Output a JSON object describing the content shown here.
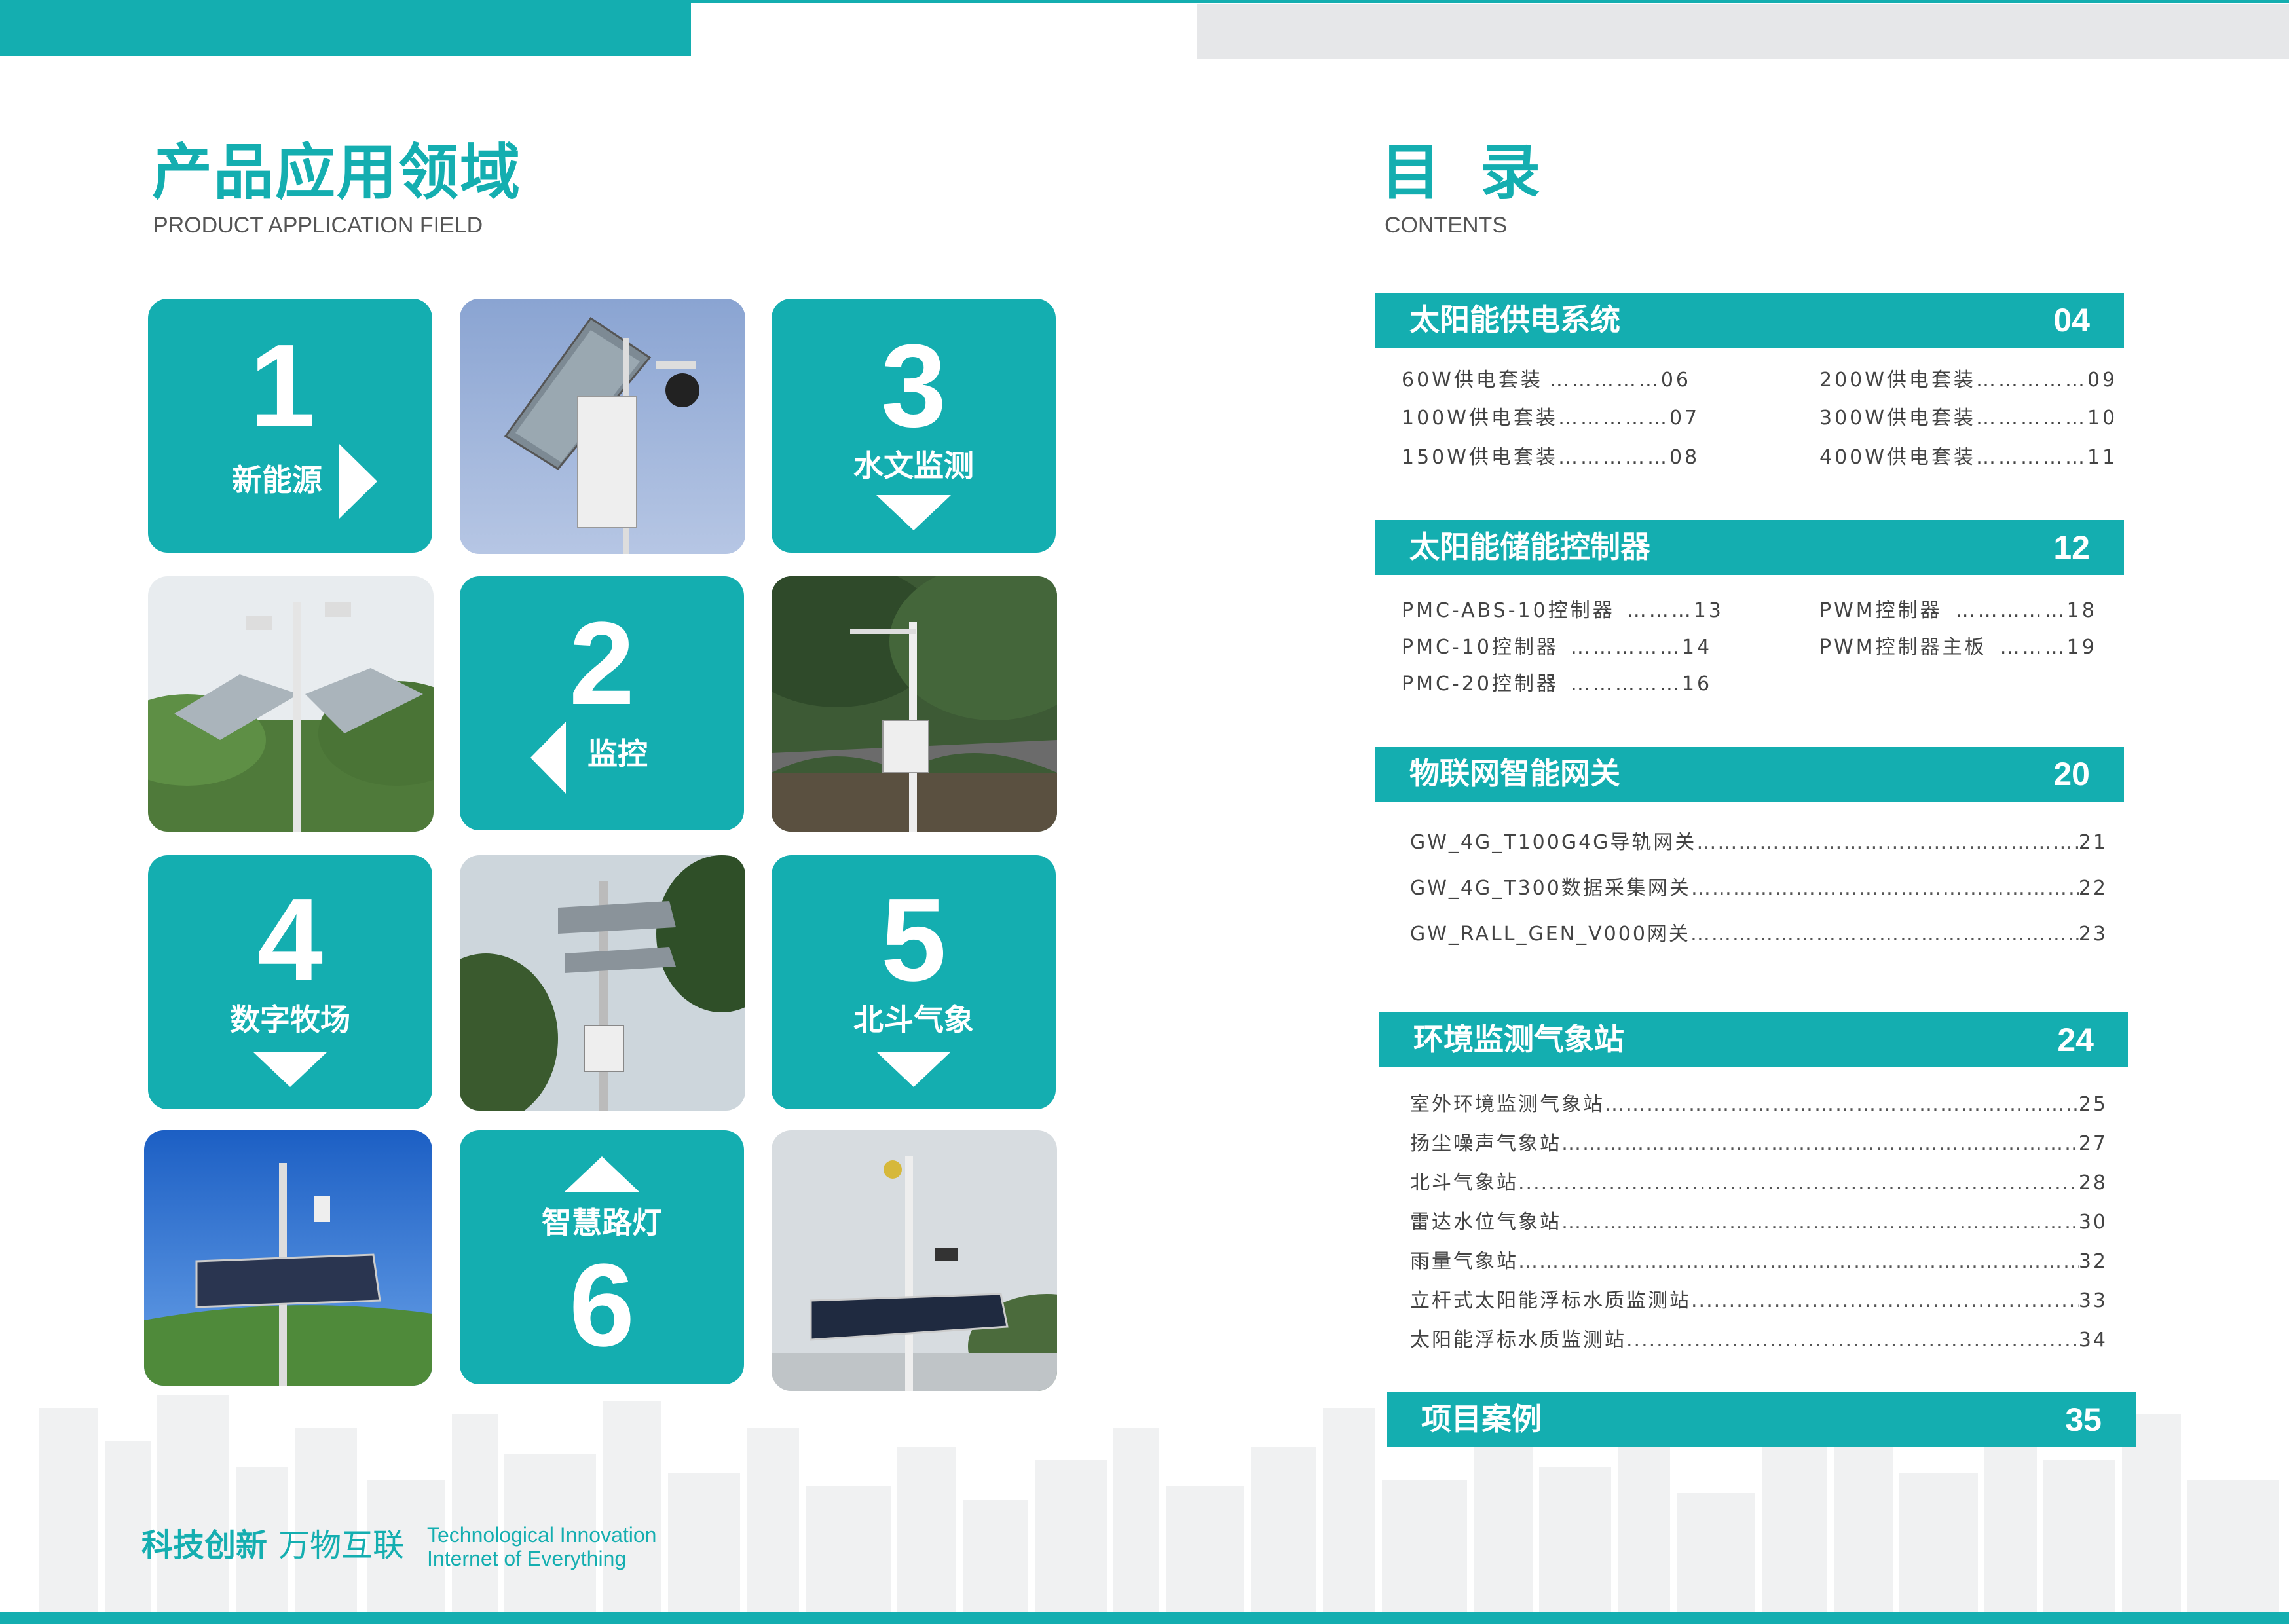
{
  "left": {
    "title": "产品应用领域",
    "subtitle": "PRODUCT APPLICATION FIELD",
    "tiles": [
      {
        "number": "1",
        "label": "新能源",
        "icon": "arrow-right-icon"
      },
      {
        "number": "3",
        "label": "水文监测",
        "icon": "arrow-down-icon"
      },
      {
        "number": "2",
        "label": "监控",
        "icon": "arrow-left-icon"
      },
      {
        "number": "4",
        "label": "数字牧场",
        "icon": "arrow-down-icon"
      },
      {
        "number": "5",
        "label": "北斗气象",
        "icon": "arrow-down-icon"
      },
      {
        "number": "6",
        "label": "智慧路灯",
        "icon": "arrow-up-icon"
      }
    ],
    "slogan_cn_bold": "科技创新",
    "slogan_cn": "万物互联",
    "slogan_en_1": "Technological Innovation",
    "slogan_en_2": "Internet of Everything"
  },
  "right": {
    "title": "目 录",
    "subtitle": "CONTENTS",
    "sections": [
      {
        "title": "太阳能供电系统",
        "page": "04",
        "items": [
          {
            "label": "60W供电套装",
            "dots": "……………",
            "page": "06"
          },
          {
            "label": "100W供电套装",
            "dots": "……………",
            "page": "07"
          },
          {
            "label": "150W供电套装",
            "dots": "……………",
            "page": "08"
          },
          {
            "label": "200W供电套装",
            "dots": "……………",
            "page": "09"
          },
          {
            "label": "300W供电套装",
            "dots": "……………",
            "page": "10"
          },
          {
            "label": "400W供电套装",
            "dots": "……………",
            "page": "11"
          }
        ]
      },
      {
        "title": "太阳能储能控制器",
        "page": "12",
        "items": [
          {
            "label": "PMC-ABS-10控制器",
            "dots": "………",
            "page": "13"
          },
          {
            "label": "PMC-10控制器",
            "dots": "……………",
            "page": "14"
          },
          {
            "label": "PMC-20控制器",
            "dots": "……………",
            "page": "16"
          },
          {
            "label": "PWM控制器",
            "dots": "……………",
            "page": "18"
          },
          {
            "label": "PWM控制器主板",
            "dots": "………",
            "page": "19"
          }
        ]
      },
      {
        "title": "物联网智能网关",
        "page": "20",
        "items": [
          {
            "label": "GW_4G_T100G4G导轨网关",
            "page": "21"
          },
          {
            "label": "GW_4G_T300数据采集网关",
            "page": "22"
          },
          {
            "label": "GW_RALL_GEN_V000网关",
            "page": "23"
          }
        ]
      },
      {
        "title": "环境监测气象站",
        "page": "24",
        "items": [
          {
            "label": "室外环境监测气象站",
            "page": "25"
          },
          {
            "label": "扬尘噪声气象站 ",
            "page": "27"
          },
          {
            "label": "北斗气象站 ",
            "page": "28"
          },
          {
            "label": "雷达水位气象站 ",
            "page": "30"
          },
          {
            "label": "雨量气象站 ",
            "page": "32"
          },
          {
            "label": "立杆式太阳能浮标水质监测站 ",
            "page": "33"
          },
          {
            "label": "太阳能浮标水质监测站 ",
            "page": "34"
          }
        ]
      },
      {
        "title": "项目案例",
        "page": "35",
        "items": []
      }
    ]
  },
  "colors": {
    "accent": "#14aeb0",
    "grey_bar": "#e6e7e9",
    "text": "#444444"
  }
}
